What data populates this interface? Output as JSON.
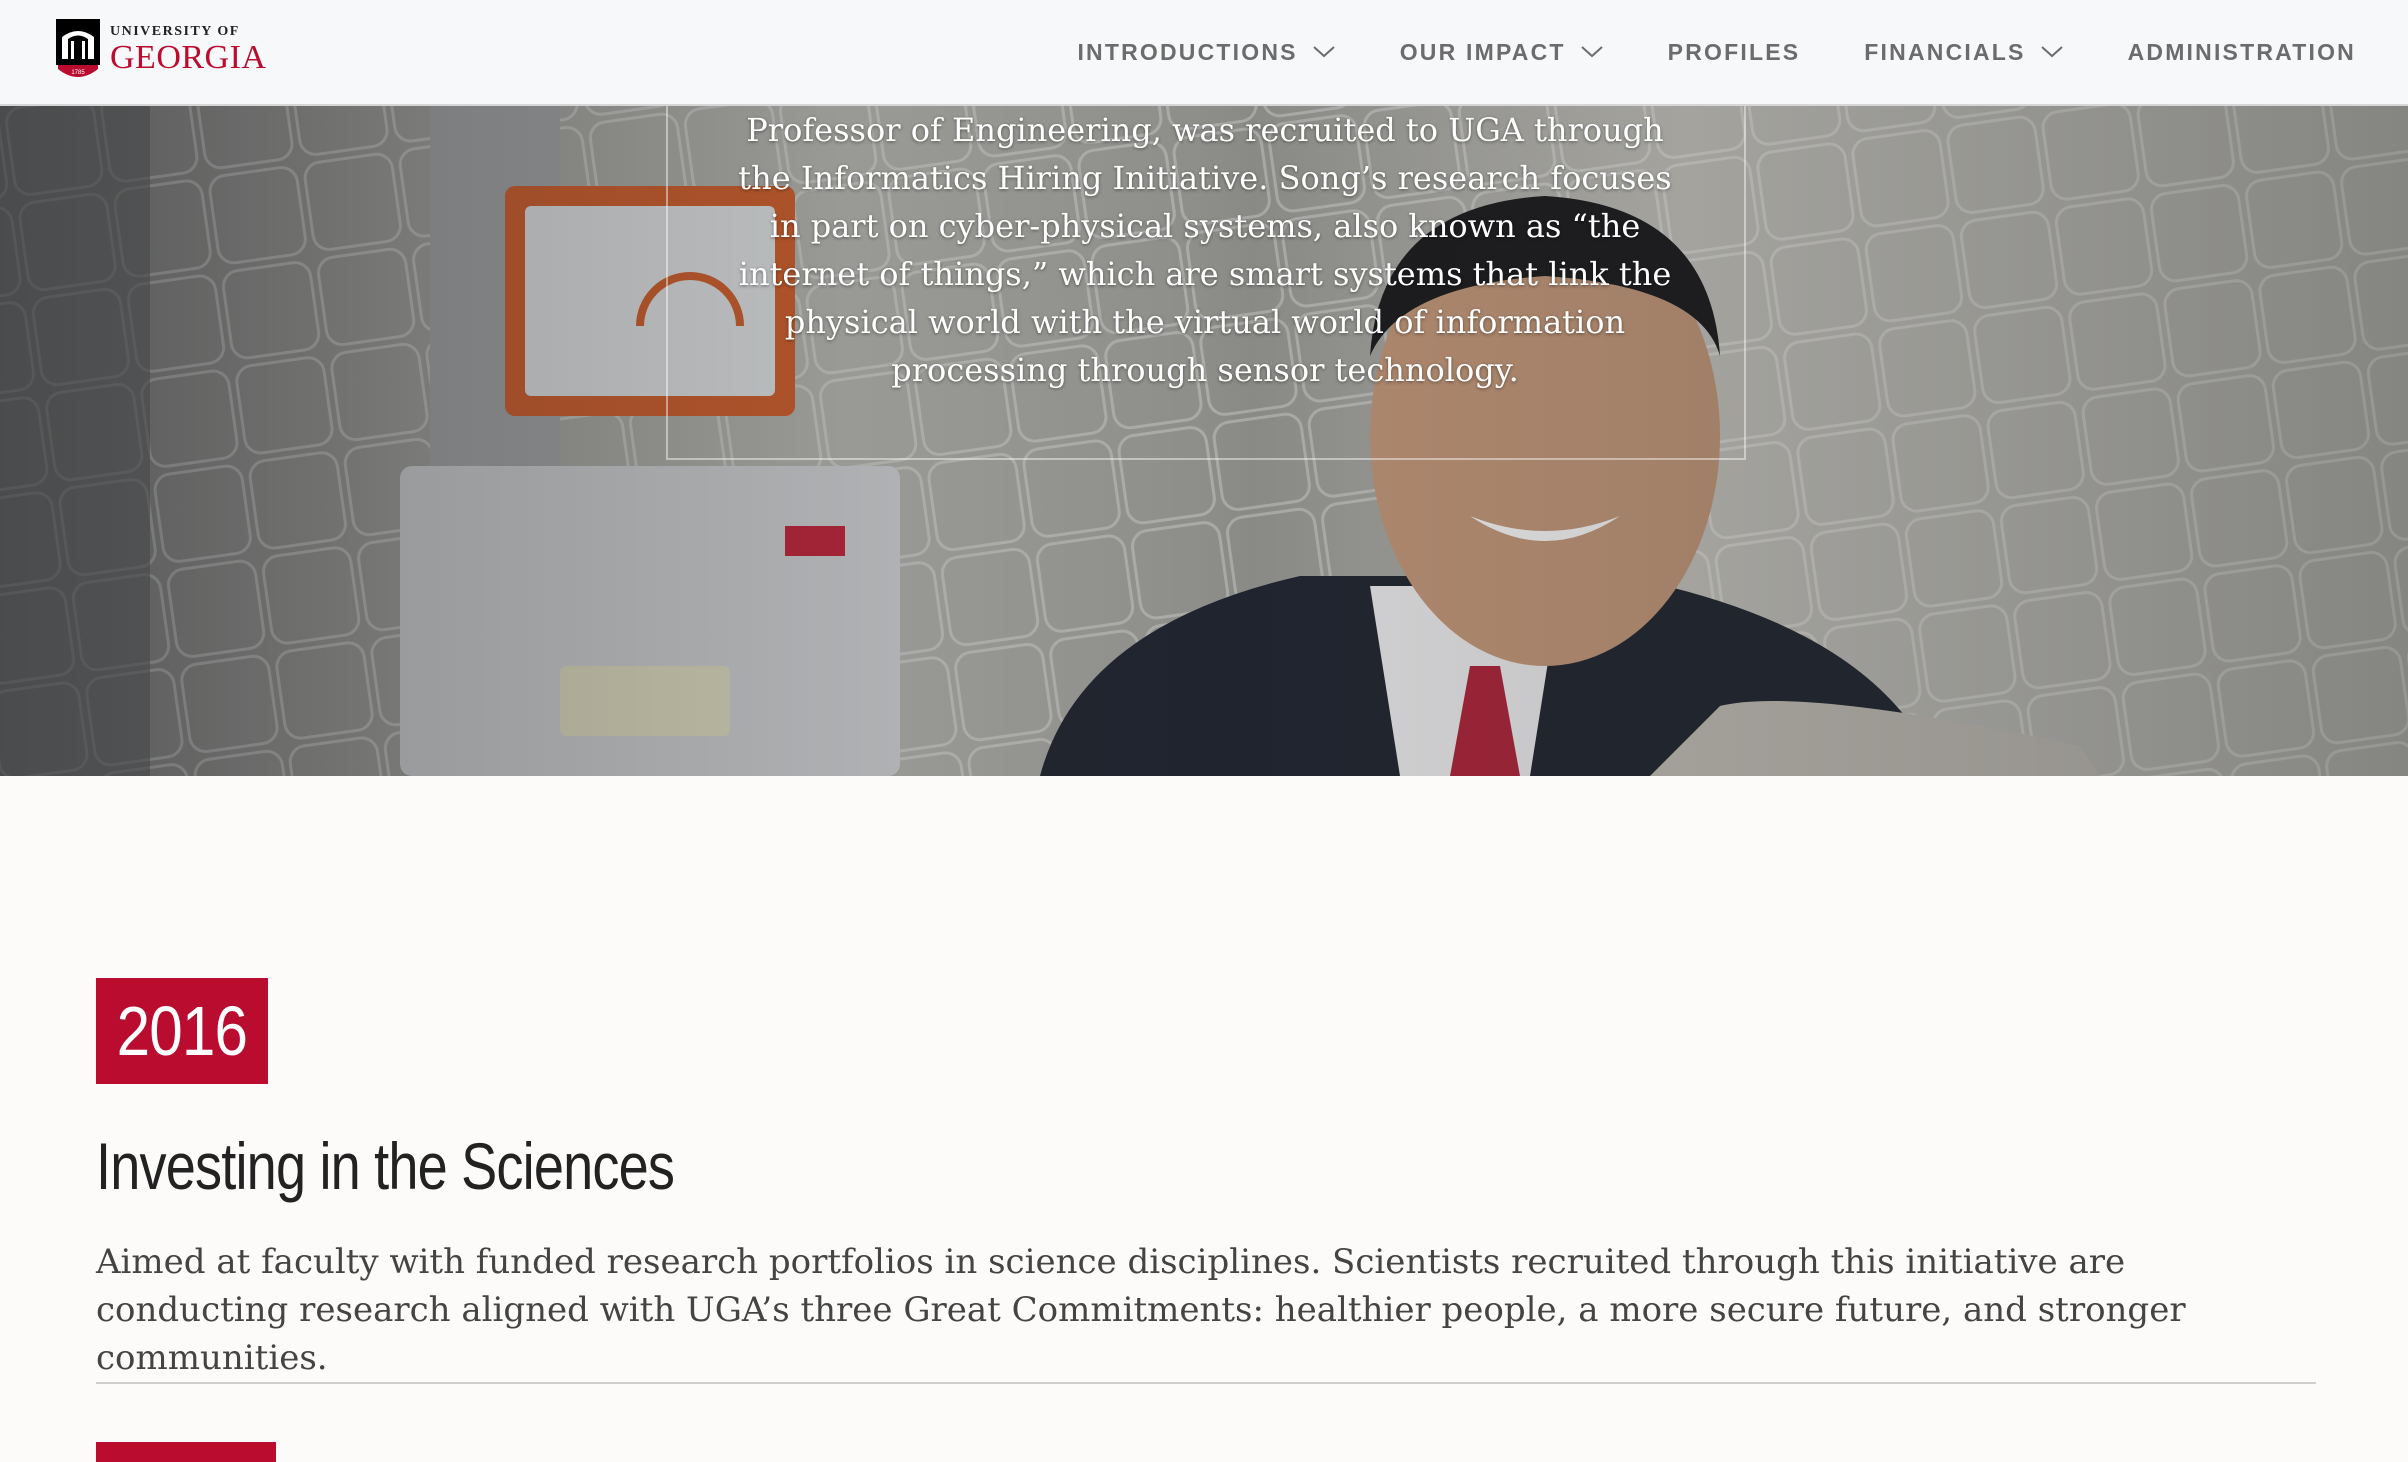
{
  "header": {
    "logo": {
      "small_text": "UNIVERSITY OF",
      "big_text": "GEORGIA",
      "alt": "University of Georgia"
    },
    "nav": [
      {
        "label": "INTRODUCTIONS",
        "has_dropdown": true
      },
      {
        "label": "OUR IMPACT",
        "has_dropdown": true
      },
      {
        "label": "PROFILES",
        "has_dropdown": false
      },
      {
        "label": "FINANCIALS",
        "has_dropdown": true
      },
      {
        "label": "ADMINISTRATION",
        "has_dropdown": false
      }
    ]
  },
  "hero": {
    "quote_lines": [
      "Professor of Engineering, was recruited to UGA through",
      "the Informatics Hiring Initiative. Song’s research focuses",
      "in part on cyber-physical systems, also known as “the",
      "internet of things,” which are smart systems that link the",
      "physical world with the virtual world of information",
      "processing through sensor technology."
    ]
  },
  "section": {
    "year": "2016",
    "title": "Investing in the Sciences",
    "body": "Aimed at faculty with funded research portfolios in science disciplines. Scientists recruited through this initiative are conducting research aligned with UGA’s three Great Commitments: healthier people, a more secure future, and stronger communities."
  },
  "colors": {
    "accent": "#ba0c2f",
    "header_bg": "#f7f8fa",
    "page_bg": "#fcfbf9"
  }
}
